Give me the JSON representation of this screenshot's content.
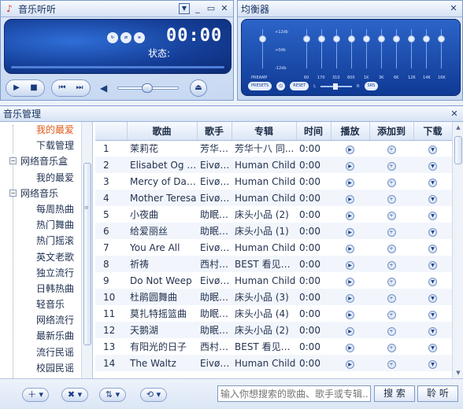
{
  "player": {
    "title": "音乐听听",
    "time": "00:00",
    "status_label": "状态:",
    "mode_icons": [
      "repeat-icon",
      "shuffle-icon",
      "list-icon"
    ]
  },
  "equalizer": {
    "title": "均衡器",
    "scale": [
      "+12db",
      "+0db",
      "-12db"
    ],
    "preamp_label": "PREAMP",
    "bands": [
      "60",
      "170",
      "310",
      "600",
      "1K",
      "3K",
      "6K",
      "12K",
      "14K",
      "16K"
    ],
    "presets_label": "PRESETS",
    "reset_label": "RESET",
    "balance_left": "L",
    "balance_right": "R",
    "srs_label": "SRS"
  },
  "library": {
    "title": "音乐管理",
    "tree": [
      {
        "label": "我的最爱",
        "level": 2,
        "active": true
      },
      {
        "label": "下载管理",
        "level": 2
      },
      {
        "label": "网络音乐盒",
        "level": 1,
        "expander": "−"
      },
      {
        "label": "我的最爱",
        "level": 2
      },
      {
        "label": "网络音乐",
        "level": 1,
        "expander": "−"
      },
      {
        "label": "每周热曲",
        "level": 2
      },
      {
        "label": "热门舞曲",
        "level": 2
      },
      {
        "label": "热门摇滚",
        "level": 2
      },
      {
        "label": "英文老歌",
        "level": 2
      },
      {
        "label": "独立流行",
        "level": 2
      },
      {
        "label": "日韩热曲",
        "level": 2
      },
      {
        "label": "轻音乐",
        "level": 2
      },
      {
        "label": "网络流行",
        "level": 2
      },
      {
        "label": "最新乐曲",
        "level": 2
      },
      {
        "label": "流行民谣",
        "level": 2
      },
      {
        "label": "校园民谣",
        "level": 2
      }
    ],
    "columns": [
      "",
      "歌曲",
      "歌手",
      "专辑",
      "时间",
      "播放",
      "添加到",
      "下载"
    ],
    "rows": [
      {
        "n": "1",
        "song": "茉莉花",
        "artist": "芳华十八",
        "album": "芳华十八 同...",
        "time": "0:00"
      },
      {
        "n": "2",
        "song": "Elisabet Og E...",
        "artist": "Eivør ...",
        "album": "Human Child",
        "time": "0:00"
      },
      {
        "n": "3",
        "song": "Mercy of Dar...",
        "artist": "Eivør ...",
        "album": "Human Child",
        "time": "0:00"
      },
      {
        "n": "4",
        "song": "Mother Teresa",
        "artist": "Eivør ...",
        "album": "Human Child",
        "time": "0:00"
      },
      {
        "n": "5",
        "song": "小夜曲",
        "artist": "助眠音乐",
        "album": "床头小品 (2)",
        "time": "0:00"
      },
      {
        "n": "6",
        "song": "给爱丽丝",
        "artist": "助眠音乐",
        "album": "床头小品 (1)",
        "time": "0:00"
      },
      {
        "n": "7",
        "song": "You Are All",
        "artist": "Eivør ...",
        "album": "Human Child",
        "time": "0:00"
      },
      {
        "n": "8",
        "song": "祈祷",
        "artist": "西村由...",
        "album": "BEST 看见幸...",
        "time": "0:00"
      },
      {
        "n": "9",
        "song": "Do Not Weep",
        "artist": "Eivør ...",
        "album": "Human Child",
        "time": "0:00"
      },
      {
        "n": "10",
        "song": "杜鹃圆舞曲",
        "artist": "助眠音乐",
        "album": "床头小品 (3)",
        "time": "0:00"
      },
      {
        "n": "11",
        "song": "莫扎特摇篮曲",
        "artist": "助眠音乐",
        "album": "床头小品 (4)",
        "time": "0:00"
      },
      {
        "n": "12",
        "song": "天鹅湖",
        "artist": "助眠音乐",
        "album": "床头小品 (2)",
        "time": "0:00"
      },
      {
        "n": "13",
        "song": "有阳光的日子",
        "artist": "西村由...",
        "album": "BEST 看见幸...",
        "time": "0:00"
      },
      {
        "n": "14",
        "song": "The Waltz",
        "artist": "Eivør ...",
        "album": "Human Child",
        "time": "0:00"
      }
    ]
  },
  "bottom": {
    "search_placeholder": "输入你想搜索的歌曲、歌手或专辑...",
    "search_button": "搜 索",
    "listen_button": "聆 听"
  }
}
